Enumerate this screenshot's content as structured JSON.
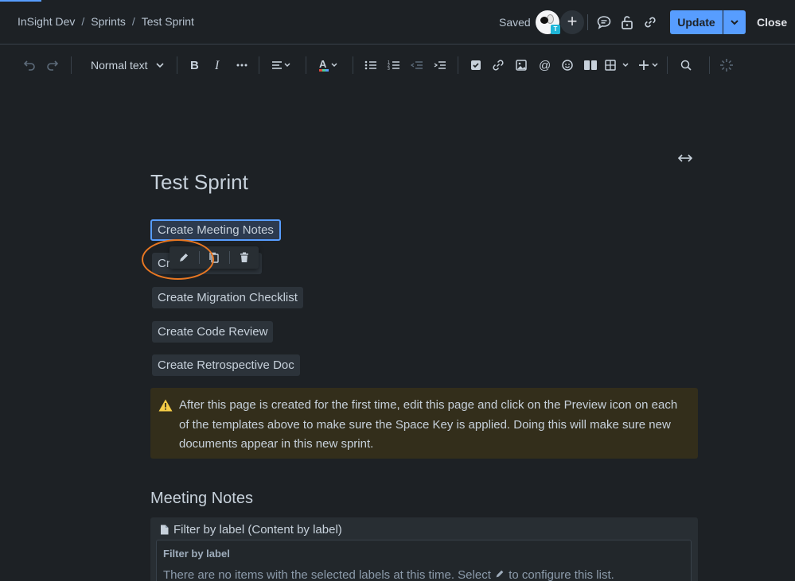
{
  "header": {
    "breadcrumb": [
      "InSight Dev",
      "Sprints",
      "Test Sprint"
    ],
    "breadcrumb_sep": "/",
    "status": "Saved",
    "avatar_badge": "T",
    "add_collaborator": "+",
    "update_label": "Update",
    "close_label": "Close"
  },
  "toolbar": {
    "text_style": "Normal text",
    "icons": [
      "undo-icon",
      "redo-icon",
      "bold-icon",
      "italic-icon",
      "more-formatting-icon",
      "align-icon",
      "text-color-icon",
      "bullet-list-icon",
      "numbered-list-icon",
      "outdent-icon",
      "indent-icon",
      "action-item-icon",
      "link-icon",
      "image-icon",
      "mention-icon",
      "emoji-icon",
      "layouts-icon",
      "table-icon",
      "insert-icon",
      "find-icon",
      "ai-icon"
    ]
  },
  "document": {
    "title": "Test Sprint",
    "template_buttons": [
      "Create Meeting Notes",
      "Cr",
      "Create Migration Checklist",
      "Create Code Review",
      "Create Retrospective Doc"
    ],
    "floating_toolbar": [
      "edit-icon",
      "copy-icon",
      "delete-icon"
    ],
    "warning": "After this page is created for the first time, edit this page and click on the Preview icon on each of the templates above to make sure the Space Key is applied. Doing this will make sure new documents appear in this new sprint.",
    "section_heading": "Meeting Notes",
    "macro": {
      "title": "Filter by label (Content by label)",
      "inner_title": "Filter by label",
      "message_prefix": "There are no items with the selected labels at this time. Select",
      "message_suffix": "to configure this list."
    }
  },
  "colors": {
    "background": "#1d2125",
    "accent": "#579dff",
    "warning_bg": "#332e1b",
    "highlight": "#e87722"
  }
}
